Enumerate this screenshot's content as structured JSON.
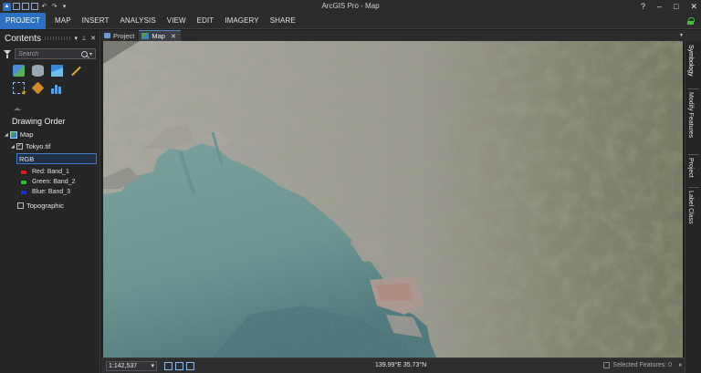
{
  "window": {
    "title": "ArcGIS Pro - Map",
    "controls": [
      "?",
      "–",
      "□",
      "✕"
    ]
  },
  "quick_access": [
    "logo",
    "new",
    "open",
    "save",
    "undo",
    "redo",
    "customize"
  ],
  "ribbon": {
    "tabs": [
      "PROJECT",
      "MAP",
      "INSERT",
      "ANALYSIS",
      "VIEW",
      "EDIT",
      "IMAGERY",
      "SHARE"
    ],
    "active": "PROJECT",
    "accent": "#2c71c1"
  },
  "contents": {
    "title": "Contents",
    "search_placeholder": "Search",
    "section_title": "Drawing Order",
    "map_label": "Map",
    "layer_label": "Tokyo.tif",
    "layer_checked": true,
    "renderer_field": "RGB",
    "bands": [
      {
        "label": "Red:",
        "band": "Band_1",
        "color": "#e01b1b"
      },
      {
        "label": "Green:",
        "band": "Band_2",
        "color": "#1fbf2a"
      },
      {
        "label": "Blue:",
        "band": "Band_3",
        "color": "#1a2fd8"
      }
    ],
    "basemap_label": "Topographic",
    "basemap_checked": false
  },
  "doc_tabs": [
    {
      "label": "Project",
      "active": false
    },
    {
      "label": "Map",
      "active": true
    }
  ],
  "status": {
    "scale": "1:142,537",
    "coordinates": "139.99°E 35.73°N",
    "selected_features": "Selected Features: 0"
  },
  "side_tabs": [
    "Symbology",
    "Modify Features",
    "Project",
    "Label Class"
  ]
}
